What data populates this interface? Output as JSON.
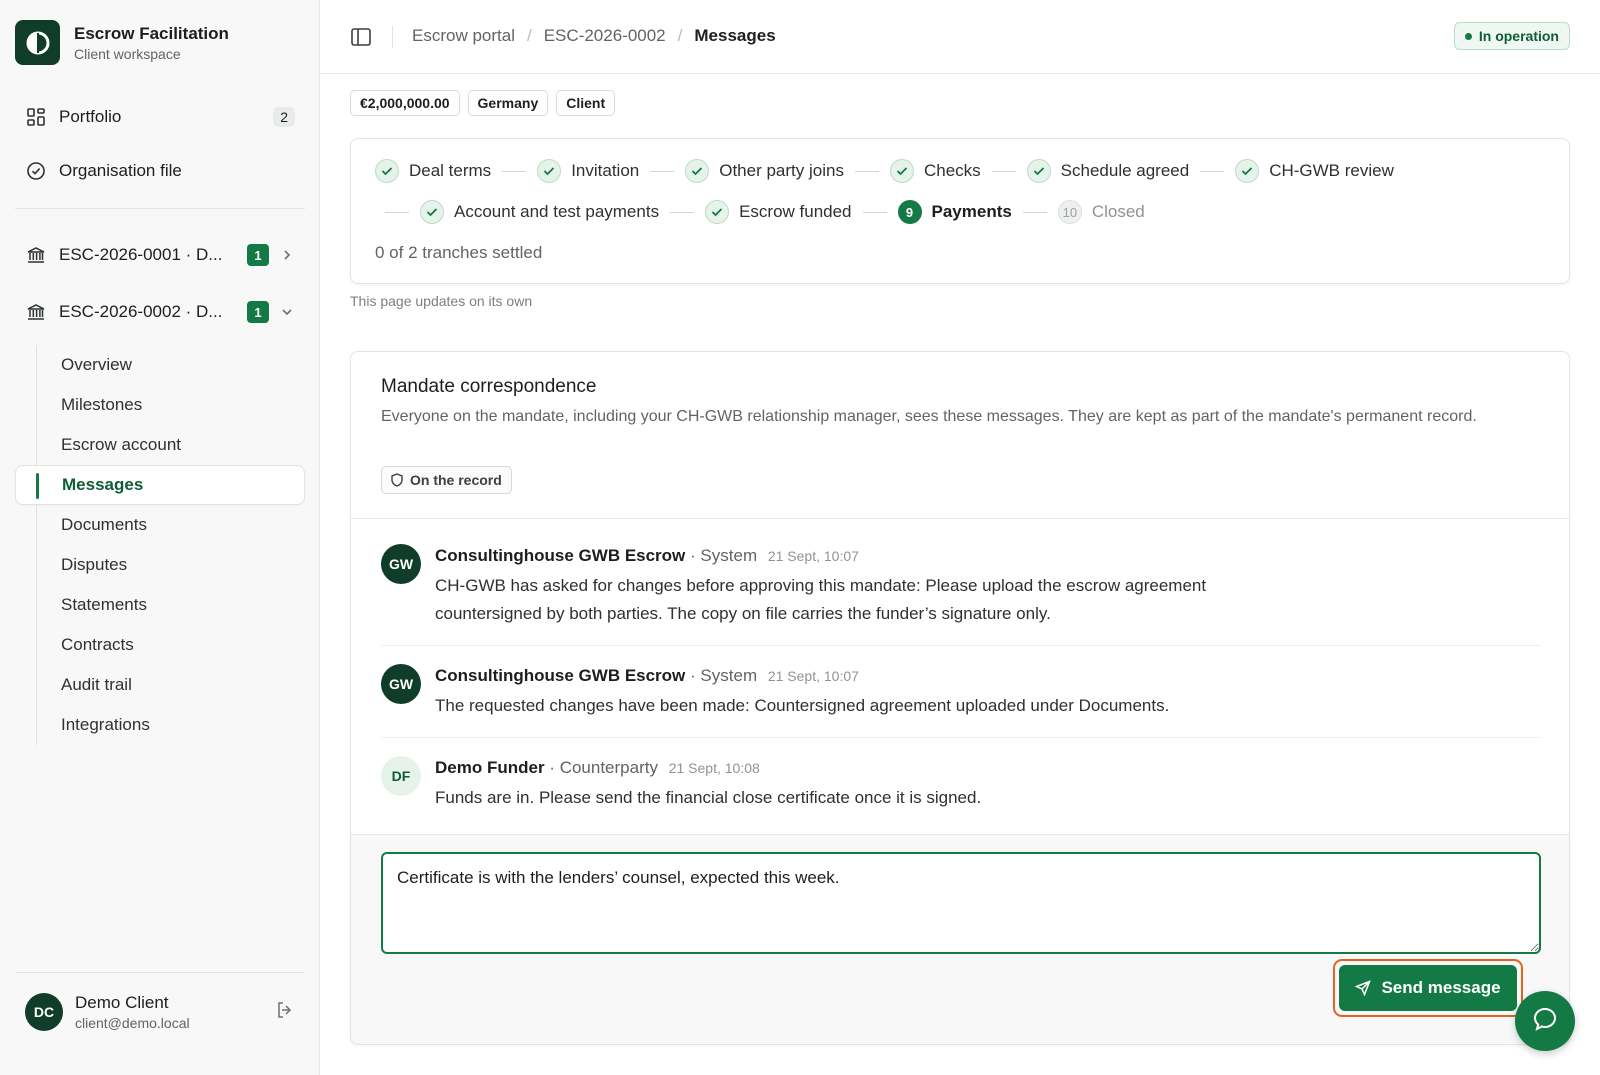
{
  "brand": {
    "title": "Escrow Facilitation",
    "subtitle": "Client workspace"
  },
  "sidebar": {
    "top_items": [
      {
        "label": "Portfolio",
        "icon": "grid-icon",
        "count": "2"
      },
      {
        "label": "Organisation file",
        "icon": "check-circle-icon"
      }
    ],
    "deals": [
      {
        "label": "ESC-2026-0001 · D...",
        "badge": "1",
        "icon": "bank-icon",
        "expanded": false
      },
      {
        "label": "ESC-2026-0002 · D...",
        "badge": "1",
        "icon": "bank-icon",
        "expanded": true
      }
    ],
    "sub_items": [
      {
        "label": "Overview"
      },
      {
        "label": "Milestones"
      },
      {
        "label": "Escrow account"
      },
      {
        "label": "Messages",
        "active": true
      },
      {
        "label": "Documents"
      },
      {
        "label": "Disputes"
      },
      {
        "label": "Statements"
      },
      {
        "label": "Contracts"
      },
      {
        "label": "Audit trail"
      },
      {
        "label": "Integrations"
      }
    ],
    "user": {
      "initials": "DC",
      "name": "Demo Client",
      "email": "client@demo.local"
    }
  },
  "header": {
    "breadcrumbs": [
      "Escrow portal",
      "ESC-2026-0002",
      "Messages"
    ],
    "status": "In operation"
  },
  "tags": [
    "€2,000,000.00",
    "Germany",
    "Client"
  ],
  "stepper": {
    "row1": [
      {
        "label": "Deal terms",
        "state": "done"
      },
      {
        "label": "Invitation",
        "state": "done"
      },
      {
        "label": "Other party joins",
        "state": "done"
      },
      {
        "label": "Checks",
        "state": "done"
      },
      {
        "label": "Schedule agreed",
        "state": "done"
      },
      {
        "label": "CH-GWB review",
        "state": "done"
      }
    ],
    "row2": [
      {
        "label": "Account and test payments",
        "state": "done"
      },
      {
        "label": "Escrow funded",
        "state": "done"
      },
      {
        "label": "Payments",
        "state": "current",
        "number": "9"
      },
      {
        "label": "Closed",
        "state": "pending",
        "number": "10"
      }
    ],
    "tranche_status": "0 of 2 tranches settled"
  },
  "updates_note": "This page updates on its own",
  "correspondence": {
    "title": "Mandate correspondence",
    "description": "Everyone on the mandate, including your CH-GWB relationship manager, sees these messages. They are kept as part of the mandate's permanent record.",
    "record_chip": "On the record",
    "messages": [
      {
        "initials": "GW",
        "author": "Consultinghouse GWB Escrow",
        "role": "System",
        "time": "21 Sept, 10:07",
        "text": "CH-GWB has asked for changes before approving this mandate: Please upload the escrow agreement countersigned by both parties. The copy on file carries the funder’s signature only."
      },
      {
        "initials": "GW",
        "author": "Consultinghouse GWB Escrow",
        "role": "System",
        "time": "21 Sept, 10:07",
        "text": "The requested changes have been made: Countersigned agreement uploaded under Documents."
      },
      {
        "initials": "DF",
        "author": "Demo Funder",
        "role": "Counterparty",
        "time": "21 Sept, 10:08",
        "text": "Funds are in. Please send the financial close certificate once it is signed."
      }
    ],
    "compose_value": "Certificate is with the lenders’ counsel, expected this week.",
    "send_label": "Send message"
  },
  "colors": {
    "accent": "#137a45",
    "brand_dark": "#0f3d2a",
    "focus_ring": "#e0651f"
  }
}
